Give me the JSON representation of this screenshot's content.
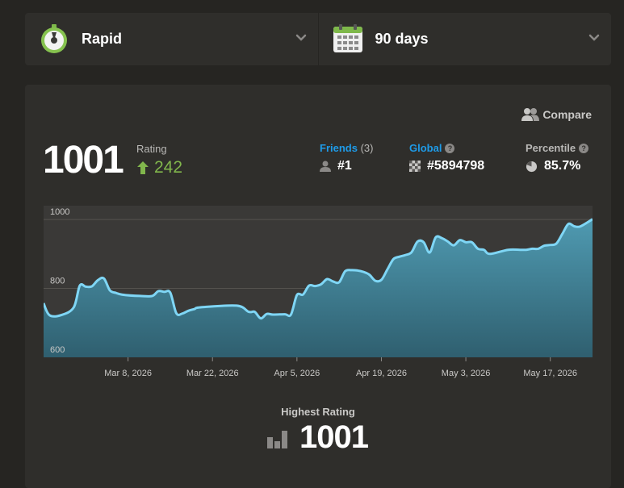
{
  "selectors": {
    "game_type": {
      "label": "Rapid",
      "icon": "stopwatch-icon"
    },
    "period": {
      "label": "90 days",
      "icon": "calendar-icon"
    }
  },
  "compare": {
    "label": "Compare"
  },
  "rating": {
    "value": "1001",
    "label": "Rating",
    "change": "242"
  },
  "stats": {
    "friends": {
      "label": "Friends",
      "count": "(3)",
      "value": "#1"
    },
    "global": {
      "label": "Global",
      "value": "#5894798"
    },
    "percentile": {
      "label": "Percentile",
      "value": "85.7%"
    }
  },
  "highest": {
    "label": "Highest Rating",
    "value": "1001"
  },
  "colors": {
    "positive": "#81b64c",
    "link": "#1e9be8",
    "line": "#7fd6f5",
    "area_top": "#4f9ab1",
    "area_bottom": "#2f5f6f",
    "plot_bg": "#3a3937"
  },
  "chart_data": {
    "type": "area",
    "xlabel": "",
    "ylabel": "",
    "ylim": [
      600,
      1040
    ],
    "yticks": [
      600,
      800,
      1000
    ],
    "grid": true,
    "x_tick_labels": [
      "Mar 8, 2026",
      "Mar 22, 2026",
      "Apr 5, 2026",
      "Apr 19, 2026",
      "May 3, 2026",
      "May 17, 2026"
    ],
    "x_tick_dates": [
      "2026-03-08",
      "2026-03-22",
      "2026-04-05",
      "2026-04-19",
      "2026-05-03",
      "2026-05-17"
    ],
    "x_range": [
      "2026-02-22",
      "2026-05-24"
    ],
    "series": [
      {
        "x": [
          "2026-02-22",
          "2026-02-23",
          "2026-02-25",
          "2026-02-27",
          "2026-02-28",
          "2026-03-01",
          "2026-03-02",
          "2026-03-03",
          "2026-03-04",
          "2026-03-05",
          "2026-03-06",
          "2026-03-07",
          "2026-03-10",
          "2026-03-12",
          "2026-03-13",
          "2026-03-14",
          "2026-03-15",
          "2026-03-16",
          "2026-03-17",
          "2026-03-18",
          "2026-03-19",
          "2026-03-20",
          "2026-03-26",
          "2026-03-28",
          "2026-03-29",
          "2026-03-30",
          "2026-03-31",
          "2026-04-01",
          "2026-04-03",
          "2026-04-04",
          "2026-04-05",
          "2026-04-06",
          "2026-04-07",
          "2026-04-08",
          "2026-04-09",
          "2026-04-10",
          "2026-04-11",
          "2026-04-12",
          "2026-04-13",
          "2026-04-14",
          "2026-04-15",
          "2026-04-16",
          "2026-04-17",
          "2026-04-18",
          "2026-04-19",
          "2026-04-20",
          "2026-04-21",
          "2026-04-22",
          "2026-04-23",
          "2026-04-24",
          "2026-04-25",
          "2026-04-26",
          "2026-04-27",
          "2026-04-28",
          "2026-04-29",
          "2026-04-30",
          "2026-05-01",
          "2026-05-02",
          "2026-05-03",
          "2026-05-04",
          "2026-05-05",
          "2026-05-06",
          "2026-05-07",
          "2026-05-10",
          "2026-05-12",
          "2026-05-13",
          "2026-05-14",
          "2026-05-15",
          "2026-05-16",
          "2026-05-17",
          "2026-05-18",
          "2026-05-19",
          "2026-05-20",
          "2026-05-21",
          "2026-05-22",
          "2026-05-24"
        ],
        "y": [
          757,
          722,
          723,
          745,
          808,
          805,
          806,
          824,
          829,
          794,
          787,
          782,
          778,
          778,
          792,
          790,
          788,
          728,
          727,
          735,
          740,
          745,
          750,
          732,
          732,
          713,
          726,
          724,
          725,
          724,
          781,
          782,
          808,
          807,
          812,
          827,
          820,
          818,
          850,
          853,
          852,
          848,
          840,
          822,
          825,
          855,
          885,
          892,
          897,
          905,
          936,
          934,
          904,
          948,
          946,
          936,
          925,
          940,
          934,
          934,
          915,
          912,
          900,
          912,
          912,
          912,
          915,
          915,
          924,
          926,
          930,
          958,
          987,
          980,
          980,
          1001
        ]
      }
    ]
  }
}
